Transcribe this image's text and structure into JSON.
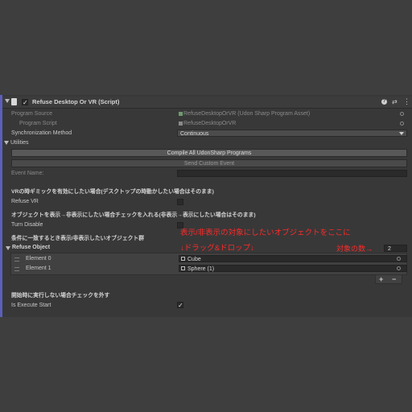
{
  "header": {
    "title": "Refuse Desktop Or VR (Script)",
    "enabled": true,
    "icons": [
      "help-icon",
      "preset-icon",
      "menu-icon"
    ]
  },
  "program_source": {
    "label": "Program Source",
    "value": "RefuseDesktopOrVR (Udon Sharp Program Asset)"
  },
  "program_script": {
    "label": "Program Script",
    "value": "RefuseDesktopOrVR"
  },
  "sync": {
    "label": "Synchronization Method",
    "value": "Continuous"
  },
  "utilities": {
    "label": "Utilities",
    "compile_button": "Compile All UdonSharp Programs",
    "send_event_button": "Send Custom Event",
    "event_name_label": "Event Name:",
    "event_name_value": ""
  },
  "section_vr": {
    "heading": "VRの時ギミックを有効にしたい場合(デスクトップの時動かしたい場合はそのまま)",
    "field_label": "Refuse VR",
    "checked": false
  },
  "section_turn": {
    "heading": "オブジェクトを表示→非表示にしたい場合チェックを入れる(非表示→表示にしたい場合はそのまま)",
    "field_label": "Turn Disable",
    "checked": false
  },
  "section_objects": {
    "heading": "条件に一致するとき表示/非表示したいオブジェクト群",
    "array_label": "Refuse Object",
    "size": "2",
    "elements": [
      {
        "label": "Element 0",
        "value": "Cube"
      },
      {
        "label": "Element 1",
        "value": "Sphere (1)"
      }
    ],
    "add_label": "+",
    "remove_label": "−"
  },
  "annotations": {
    "line1": "表示/非表示の対象にしたいオブジェクトをここに",
    "line2": "↓ドラッグ&ドロップ↓",
    "count": "対象の数→",
    "color": "#ff2a2a"
  },
  "section_start": {
    "heading": "開始時に実行しない場合チェックを外す",
    "field_label": "Is Execute Start",
    "checked": true
  },
  "colors": {
    "accent": "#5b5fb8",
    "panel": "#383838",
    "background": "#3e3e3e"
  }
}
